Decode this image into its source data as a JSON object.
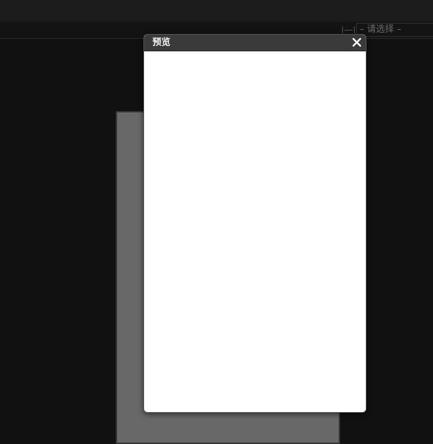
{
  "toolbar": {
    "width_icon": "width-arrows-icon",
    "select_value": "– 请选择 –"
  },
  "dialog": {
    "title": "预览",
    "close_icon": "close-icon"
  },
  "colors": {
    "background": "#111111",
    "dialog_header": "#3a3a3a",
    "canvas_page": "#686868"
  }
}
